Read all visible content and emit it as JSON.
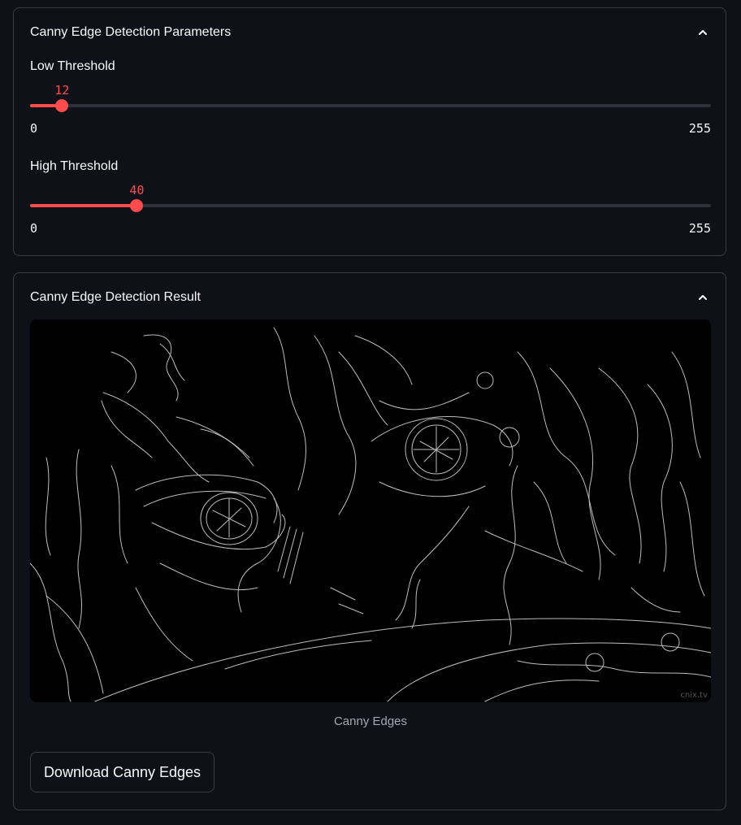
{
  "params_panel": {
    "title": "Canny Edge Detection Parameters",
    "low": {
      "label": "Low Threshold",
      "value": 12,
      "value_text": "12",
      "min": "0",
      "max": "255"
    },
    "high": {
      "label": "High Threshold",
      "value": 40,
      "value_text": "40",
      "min": "0",
      "max": "255"
    }
  },
  "result_panel": {
    "title": "Canny Edge Detection Result",
    "caption": "Canny Edges",
    "watermark": "cnix.tv",
    "download_label": "Download Canny Edges"
  },
  "colors": {
    "accent": "#ff4b4b",
    "background": "#0e1117",
    "border": "#3a3d46"
  },
  "icons": {
    "collapse": "chevron-up-icon"
  }
}
